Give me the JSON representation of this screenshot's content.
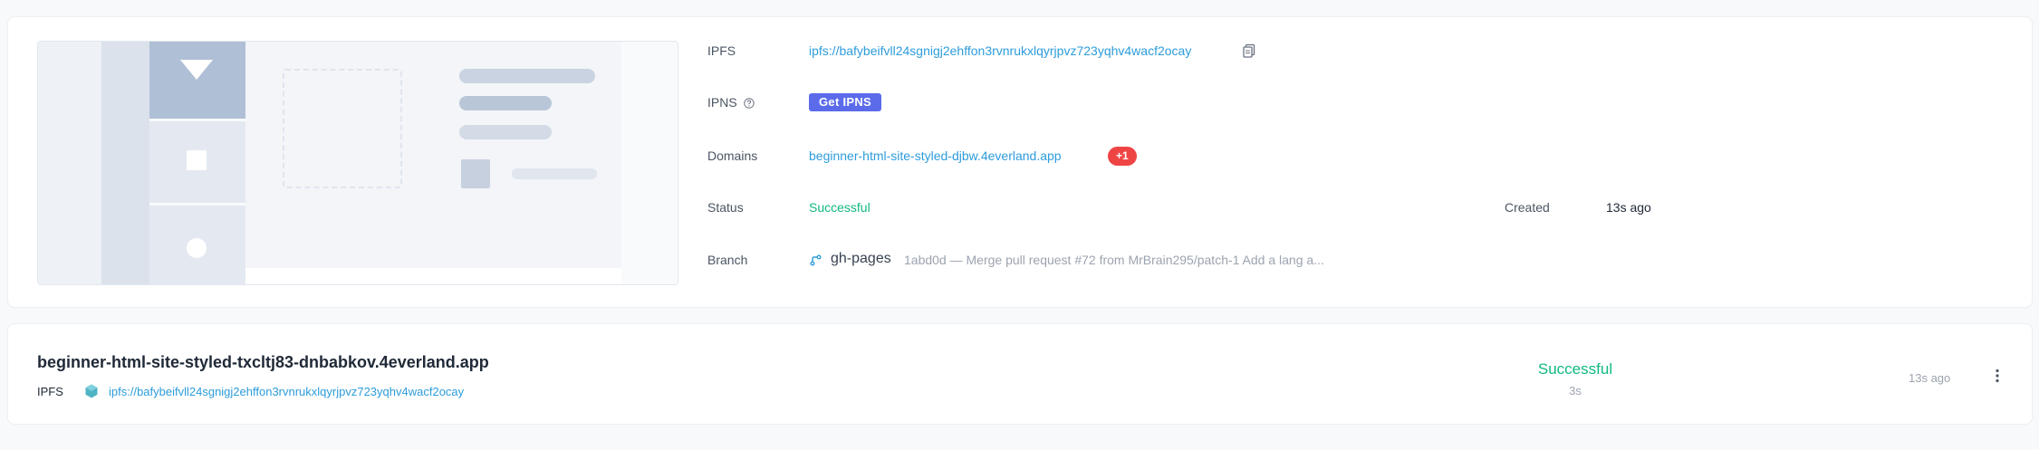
{
  "overview": {
    "ipfs_label": "IPFS",
    "ipfs_value": "ipfs://bafybeifvll24sgnigj2ehffon3rvnrukxlqyrjpvz723yqhv4wacf2ocay",
    "ipns_label": "IPNS",
    "get_ipns_label": "Get IPNS",
    "domains_label": "Domains",
    "domain_value": "beginner-html-site-styled-djbw.4everland.app",
    "domains_more": "+1",
    "status_label": "Status",
    "status_value": "Successful",
    "created_label": "Created",
    "created_value": "13s ago",
    "branch_label": "Branch",
    "branch_name": "gh-pages",
    "commit_message": "1abd0d — Merge pull request #72 from MrBrain295/patch-1 Add a lang a..."
  },
  "deployment": {
    "title": "beginner-html-site-styled-txcltj83-dnbabkov.4everland.app",
    "ipfs_label": "IPFS",
    "ipfs_value": "ipfs://bafybeifvll24sgnigj2ehffon3rvnrukxlqyrjpvz723yqhv4wacf2ocay",
    "status": "Successful",
    "duration": "3s",
    "time": "13s ago"
  },
  "icons": {
    "copy": "copy-icon",
    "help": "help-circle-icon",
    "branch": "git-branch-icon",
    "ipfs": "ipfs-hexagon-icon",
    "more": "more-vertical-icon"
  },
  "colors": {
    "link": "#2d9cdb",
    "success": "#10b981",
    "ipns_badge": "#5b6bea",
    "more_badge": "#ef4444"
  }
}
